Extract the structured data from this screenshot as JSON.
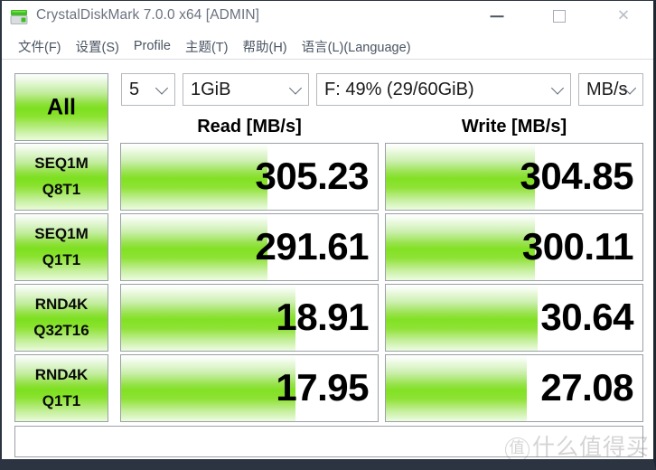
{
  "window": {
    "title": "CrystalDiskMark 7.0.0 x64 [ADMIN]",
    "icon": "crystaldiskmark-icon",
    "controls": {
      "minimize": "—",
      "maximize": "□",
      "close": "✕"
    }
  },
  "menu": {
    "items": [
      {
        "label": "文件(F)"
      },
      {
        "label": "设置(S)"
      },
      {
        "label": "Profile"
      },
      {
        "label": "主题(T)"
      },
      {
        "label": "帮助(H)"
      },
      {
        "label": "语言(L)(Language)"
      }
    ]
  },
  "toolbar": {
    "all_button": "All",
    "run_count": "5",
    "test_size": "1GiB",
    "drive": "F: 49% (29/60GiB)",
    "unit": "MB/s"
  },
  "headers": {
    "read": "Read [MB/s]",
    "write": "Write [MB/s]"
  },
  "results": {
    "rows": [
      {
        "label_line1": "SEQ1M",
        "label_line2": "Q8T1",
        "read": "305.23",
        "write": "304.85",
        "read_bar_pct": 57,
        "write_bar_pct": 58
      },
      {
        "label_line1": "SEQ1M",
        "label_line2": "Q1T1",
        "read": "291.61",
        "write": "300.11",
        "read_bar_pct": 57,
        "write_bar_pct": 58
      },
      {
        "label_line1": "RND4K",
        "label_line2": "Q32T16",
        "read": "18.91",
        "write": "30.64",
        "read_bar_pct": 68,
        "write_bar_pct": 59
      },
      {
        "label_line1": "RND4K",
        "label_line2": "Q1T1",
        "read": "17.95",
        "write": "27.08",
        "read_bar_pct": 68,
        "write_bar_pct": 55
      }
    ]
  },
  "comment": {
    "value": ""
  },
  "watermark": {
    "mark": "值",
    "text": "什么值得买"
  },
  "colors": {
    "bar_green": "#7ce01f",
    "title_text": "#6b7280",
    "menu_text": "#4b5563",
    "value_text": "#000000"
  }
}
